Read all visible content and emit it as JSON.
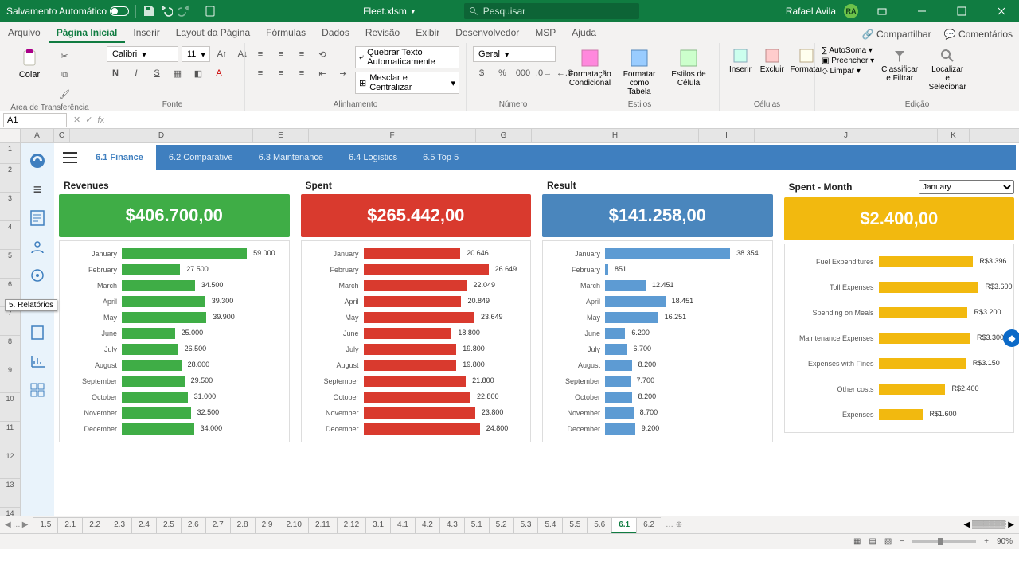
{
  "titlebar": {
    "autosave": "Salvamento Automático",
    "filename": "Fleet.xlsm",
    "search_placeholder": "Pesquisar",
    "user": "Rafael Avila",
    "initials": "RA"
  },
  "menubar": {
    "tabs": [
      "Arquivo",
      "Página Inicial",
      "Inserir",
      "Layout da Página",
      "Fórmulas",
      "Dados",
      "Revisão",
      "Exibir",
      "Desenvolvedor",
      "MSP",
      "Ajuda"
    ],
    "active_index": 1,
    "share": "Compartilhar",
    "comments": "Comentários"
  },
  "ribbon": {
    "clipboard": {
      "paste": "Colar",
      "label": "Área de Transferência"
    },
    "font": {
      "name": "Calibri",
      "size": "11",
      "label": "Fonte",
      "bold": "N",
      "italic": "I",
      "underline": "S"
    },
    "alignment": {
      "wrap": "Quebrar Texto Automaticamente",
      "merge": "Mesclar e Centralizar",
      "label": "Alinhamento"
    },
    "number": {
      "format": "Geral",
      "label": "Número"
    },
    "styles": {
      "condfmt": "Formatação Condicional",
      "astable": "Formatar como Tabela",
      "cellstyle": "Estilos de Célula",
      "label": "Estilos"
    },
    "cells": {
      "insert": "Inserir",
      "delete": "Excluir",
      "format": "Formatar",
      "label": "Células"
    },
    "editing": {
      "autosum": "AutoSoma",
      "fill": "Preencher",
      "clear": "Limpar",
      "sort": "Classificar e Filtrar",
      "find": "Localizar e Selecionar",
      "label": "Edição"
    }
  },
  "namebox": "A1",
  "columns": [
    "A",
    "C",
    "D",
    "E",
    "F",
    "G",
    "H",
    "I",
    "J",
    "K"
  ],
  "rows": [
    "1",
    "2",
    "3",
    "4",
    "5",
    "6",
    "7",
    "8",
    "9",
    "10",
    "11",
    "12",
    "13",
    "14"
  ],
  "tooltip_icon": "5. Relatórios",
  "dashboard": {
    "tabs": [
      "6.1 Finance",
      "6.2 Comparative",
      "6.3 Maintenance",
      "6.4 Logistics",
      "6.5 Top 5"
    ],
    "active_index": 0
  },
  "month_selected": "January",
  "kpis": {
    "revenues": {
      "title": "Revenues",
      "value": "$406.700,00"
    },
    "spent": {
      "title": "Spent",
      "value": "$265.442,00"
    },
    "result": {
      "title": "Result",
      "value": "$141.258,00"
    },
    "spent_month": {
      "title": "Spent - Month",
      "value": "$2.400,00"
    }
  },
  "chart_data": [
    {
      "type": "bar",
      "title": "Revenues",
      "max": 59000,
      "categories": [
        "January",
        "February",
        "March",
        "April",
        "May",
        "June",
        "July",
        "August",
        "September",
        "October",
        "November",
        "December"
      ],
      "values": [
        59000,
        27500,
        34500,
        39300,
        39900,
        25000,
        26500,
        28000,
        29500,
        31000,
        32500,
        34000
      ],
      "labels": [
        "59.000",
        "27.500",
        "34.500",
        "39.300",
        "39.900",
        "25.000",
        "26.500",
        "28.000",
        "29.500",
        "31.000",
        "32.500",
        "34.000"
      ]
    },
    {
      "type": "bar",
      "title": "Spent",
      "max": 26649,
      "categories": [
        "January",
        "February",
        "March",
        "April",
        "May",
        "June",
        "July",
        "August",
        "September",
        "October",
        "November",
        "December"
      ],
      "values": [
        20646,
        26649,
        22049,
        20849,
        23649,
        18800,
        19800,
        19800,
        21800,
        22800,
        23800,
        24800
      ],
      "labels": [
        "20.646",
        "26.649",
        "22.049",
        "20.849",
        "23.649",
        "18.800",
        "19.800",
        "19.800",
        "21.800",
        "22.800",
        "23.800",
        "24.800"
      ]
    },
    {
      "type": "bar",
      "title": "Result",
      "max": 38354,
      "categories": [
        "January",
        "February",
        "March",
        "April",
        "May",
        "June",
        "July",
        "August",
        "September",
        "October",
        "November",
        "December"
      ],
      "values": [
        38354,
        851,
        12451,
        18451,
        16251,
        6200,
        6700,
        8200,
        7700,
        8200,
        8700,
        9200
      ],
      "labels": [
        "38.354",
        "851",
        "12.451",
        "18.451",
        "16.251",
        "6.200",
        "6.700",
        "8.200",
        "7.700",
        "8.200",
        "8.700",
        "9.200"
      ]
    },
    {
      "type": "bar",
      "title": "Spent - Month",
      "max": 3600,
      "categories": [
        "Fuel Expenditures",
        "Toll Expenses",
        "Spending on Meals",
        "Maintenance Expenses",
        "Expenses with Fines",
        "Other costs",
        "Expenses"
      ],
      "values": [
        3396,
        3600,
        3200,
        3300,
        3150,
        2400,
        1600
      ],
      "labels": [
        "R$3.396",
        "R$3.600",
        "R$3.200",
        "R$3.300",
        "R$3.150",
        "R$2.400",
        "R$1.600"
      ]
    }
  ],
  "sheet_tabs": [
    "1.5",
    "2.1",
    "2.2",
    "2.3",
    "2.4",
    "2.5",
    "2.6",
    "2.7",
    "2.8",
    "2.9",
    "2.10",
    "2.11",
    "2.12",
    "3.1",
    "4.1",
    "4.2",
    "4.3",
    "5.1",
    "5.2",
    "5.3",
    "5.4",
    "5.5",
    "5.6",
    "6.1",
    "6.2"
  ],
  "sheet_active": "6.1",
  "statusbar": {
    "zoom": "90%"
  }
}
